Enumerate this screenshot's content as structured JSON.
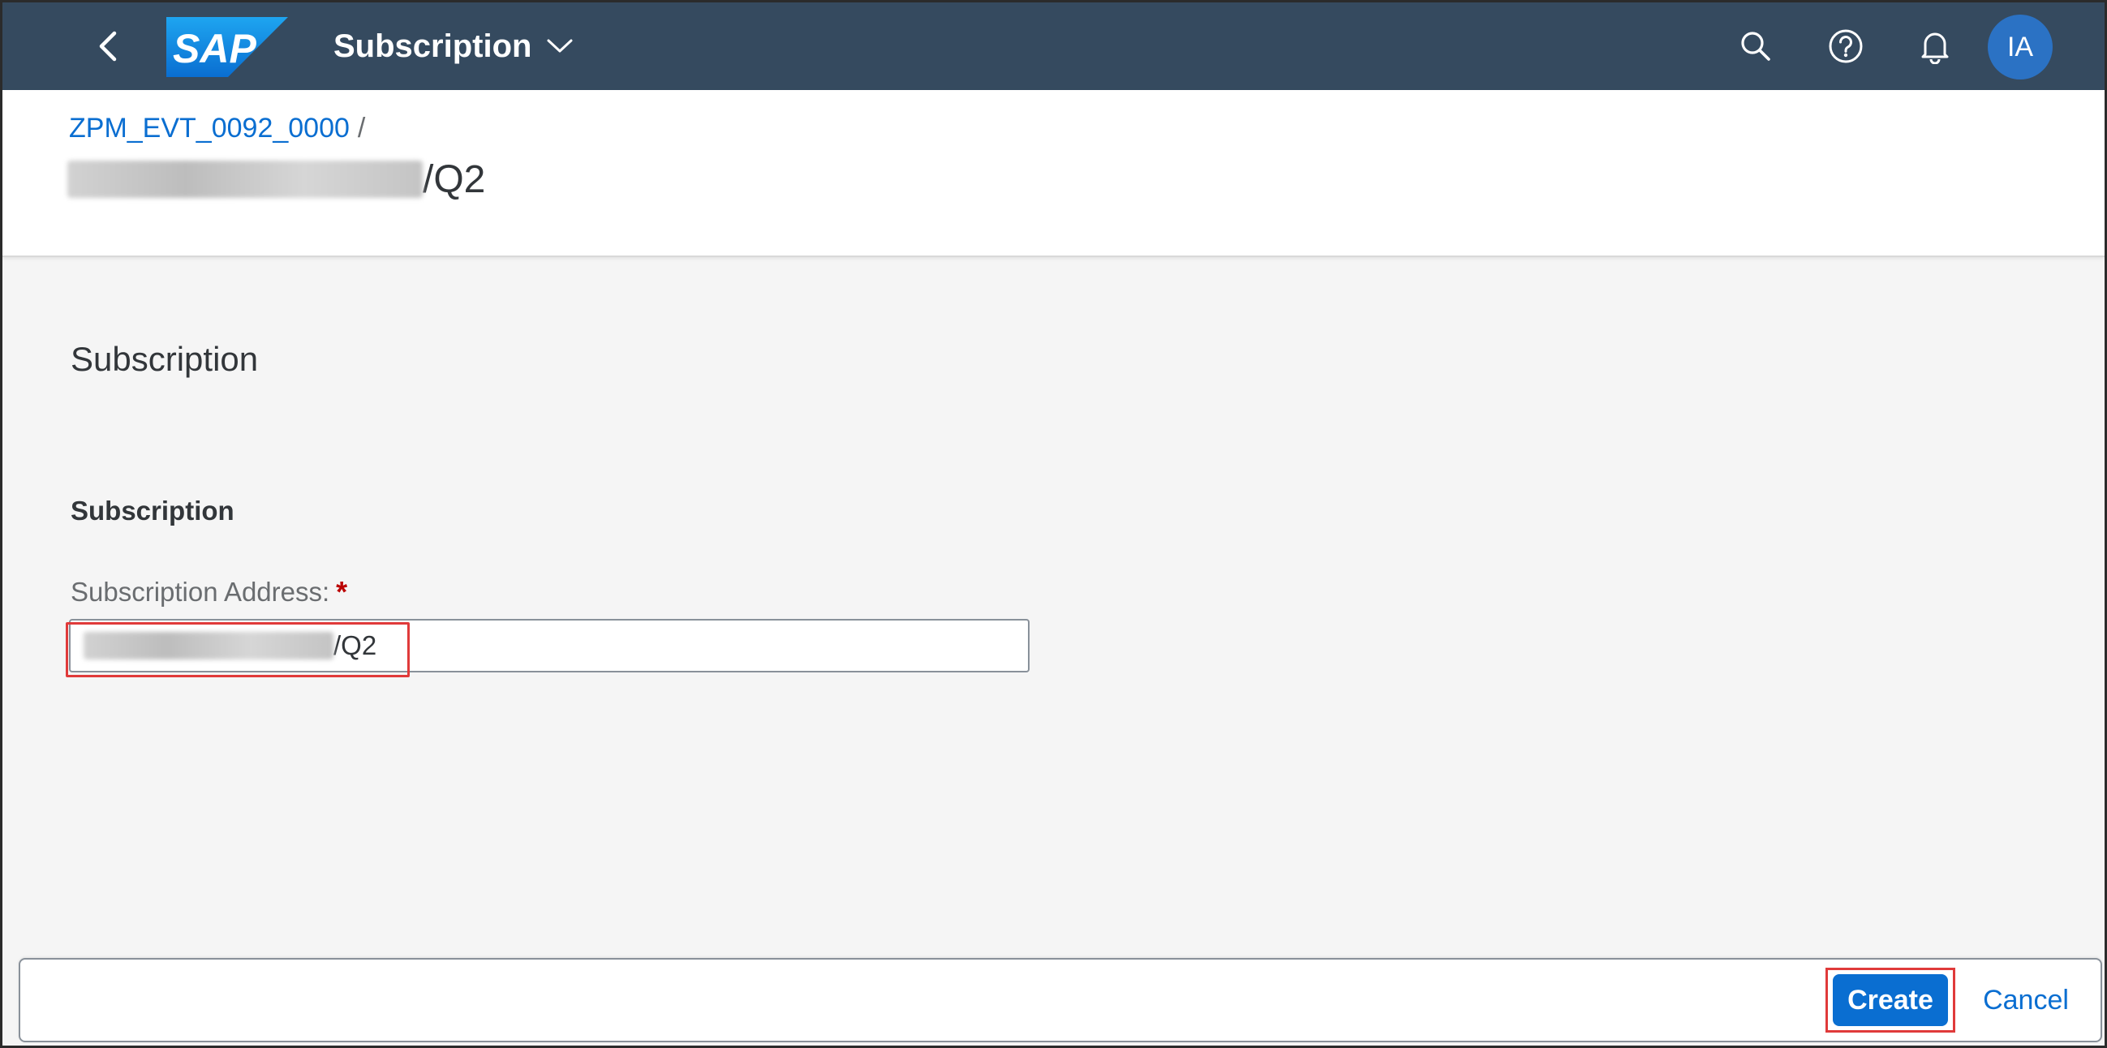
{
  "shellbar": {
    "app_title": "Subscription",
    "avatar_initials": "IA",
    "logo_text": "SAP",
    "icons": [
      "back-icon",
      "chevron-down-icon",
      "search-icon",
      "help-icon",
      "notification-icon"
    ]
  },
  "header": {
    "breadcrumb_link": "ZPM_EVT_0092_0000",
    "breadcrumb_separator": "/",
    "title_suffix": "/Q2"
  },
  "content": {
    "section_title": "Subscription",
    "group_title": "Subscription",
    "field_label": "Subscription Address:",
    "required_marker": "*",
    "field_value_suffix": "/Q2"
  },
  "footer": {
    "create_label": "Create",
    "cancel_label": "Cancel"
  },
  "colors": {
    "shellbar": "#354a5f",
    "accent": "#0a6ed1",
    "avatar": "#2b72c4",
    "highlight": "#e03a3a",
    "required": "#bb0000"
  }
}
